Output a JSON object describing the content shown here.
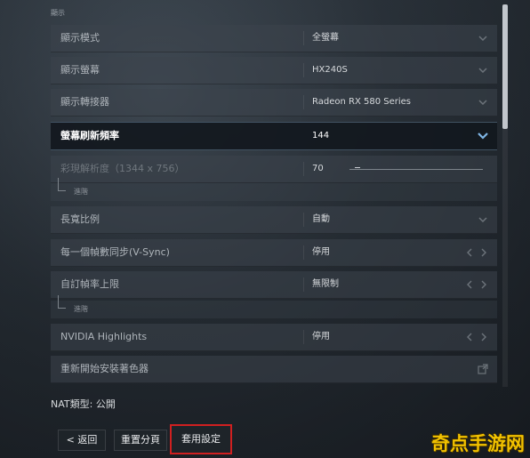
{
  "section_title": "顯示",
  "rows": [
    {
      "label": "顯示模式",
      "value": "全螢幕",
      "control": "dropdown"
    },
    {
      "label": "顯示螢幕",
      "value": "HX240S",
      "control": "dropdown"
    },
    {
      "label": "顯示轉接器",
      "value": "Radeon RX 580 Series",
      "control": "dropdown"
    },
    {
      "label": "螢幕刷新頻率",
      "value": "144",
      "control": "dropdown",
      "active": true
    },
    {
      "label": "彩現解析度（1344 x 756）",
      "value": "70",
      "control": "slider",
      "sub": "進階"
    },
    {
      "label": "長寬比例",
      "value": "自動",
      "control": "dropdown"
    },
    {
      "label": "每一個幀數同步(V-Sync)",
      "value": "停用",
      "control": "arrows"
    },
    {
      "label": "自訂幀率上限",
      "value": "無限制",
      "control": "arrows",
      "sub": "進階"
    },
    {
      "label": "NVIDIA Highlights",
      "value": "停用",
      "control": "arrows"
    },
    {
      "label": "重新開始安裝著色器",
      "value": "",
      "control": "external"
    }
  ],
  "nat": {
    "label": "NAT類型:",
    "value": "公開"
  },
  "buttons": {
    "back": "< 返回",
    "reset": "重置分頁",
    "apply": "套用設定"
  },
  "watermark": "奇点手游网",
  "colors": {
    "highlight": "#d02020",
    "active_chevron": "#7fb6e6"
  }
}
